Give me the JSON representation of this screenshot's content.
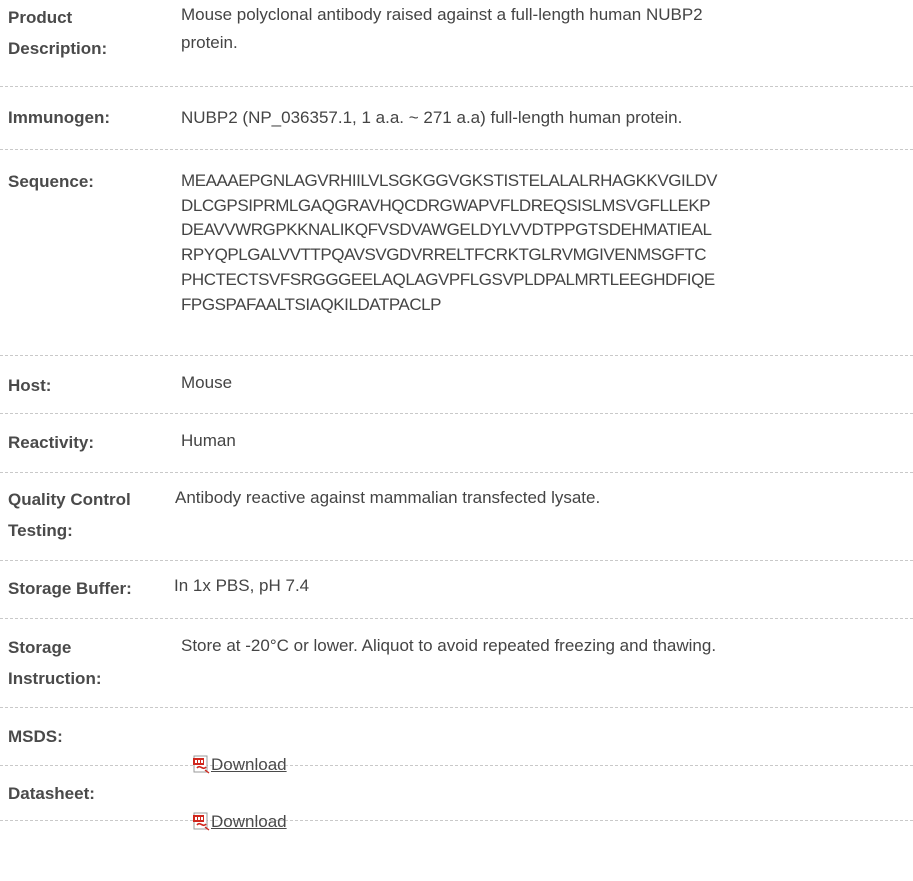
{
  "rows": [
    {
      "label": "Product\nDescription:",
      "value": "Mouse polyclonal antibody raised against a full-length human NUBP2\nprotein."
    },
    {
      "label": "Immunogen:",
      "value": "NUBP2 (NP_036357.1, 1 a.a. ~ 271 a.a) full-length human protein."
    },
    {
      "label": "Sequence:",
      "value": "MEAAAEPGNLAGVRHIILVLSGKGGVGKSTISTELALALRHAGKKVGILDV\nDLCGPSIPRMLGAQGRAVHQCDRGWAPVFLDREQSISLMSVGFLLEKP\nDEAVVWRGPKKNALIKQFVSDVAWGELDYLVVDTPPGTSDEHMATIEAL\nRPYQPLGALVVTTPQAVSVGDVRRELTFCRKTGLRVMGIVENMSGFTC\nPHCTECTSVFSRGGGEELAQLAGVPFLGSVPLDPALMRTLEEGHDFIQE\nFPGSPAFAALTSIAQKILDATPACLP"
    },
    {
      "label": "Host:",
      "value": "Mouse"
    },
    {
      "label": "Reactivity:",
      "value": "Human"
    },
    {
      "label": "Quality Control\nTesting:",
      "value": "Antibody reactive against mammalian transfected lysate."
    },
    {
      "label": "Storage Buffer:",
      "value": "In 1x PBS, pH 7.4"
    },
    {
      "label": "Storage\nInstruction:",
      "value": "Store at -20°C or lower. Aliquot to avoid repeated freezing and thawing."
    },
    {
      "label": "MSDS:",
      "link_text": "Download",
      "icon": "pdf-icon"
    },
    {
      "label": "Datasheet:",
      "link_text": "Download",
      "icon": "pdf-icon"
    }
  ],
  "colors": {
    "label_text": "#4a4a4a",
    "value_text": "#444444",
    "divider": "#c9c9c9",
    "pdf_icon_red": "#d0271d"
  }
}
